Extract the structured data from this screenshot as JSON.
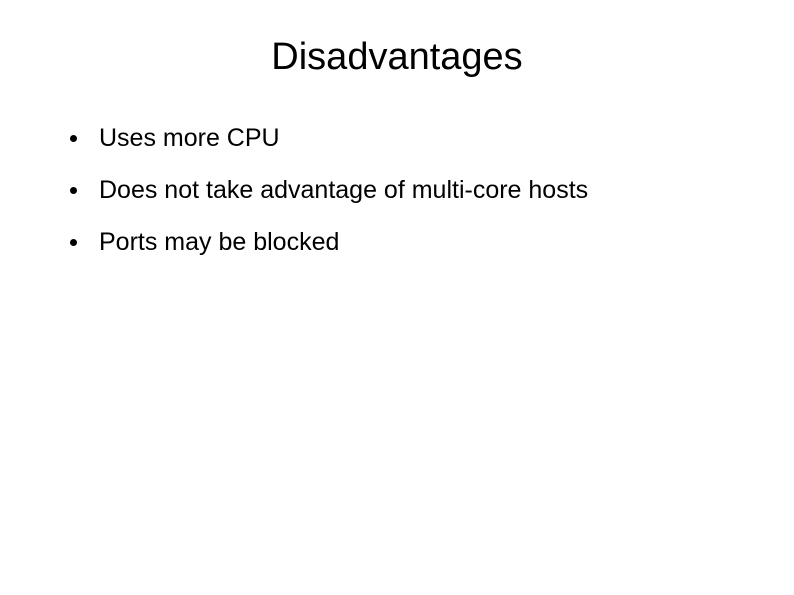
{
  "slide": {
    "title": "Disadvantages",
    "bullets": [
      {
        "text": "Uses more CPU"
      },
      {
        "text": "Does not take advantage of multi-core hosts"
      },
      {
        "text": "Ports may be blocked"
      }
    ]
  }
}
